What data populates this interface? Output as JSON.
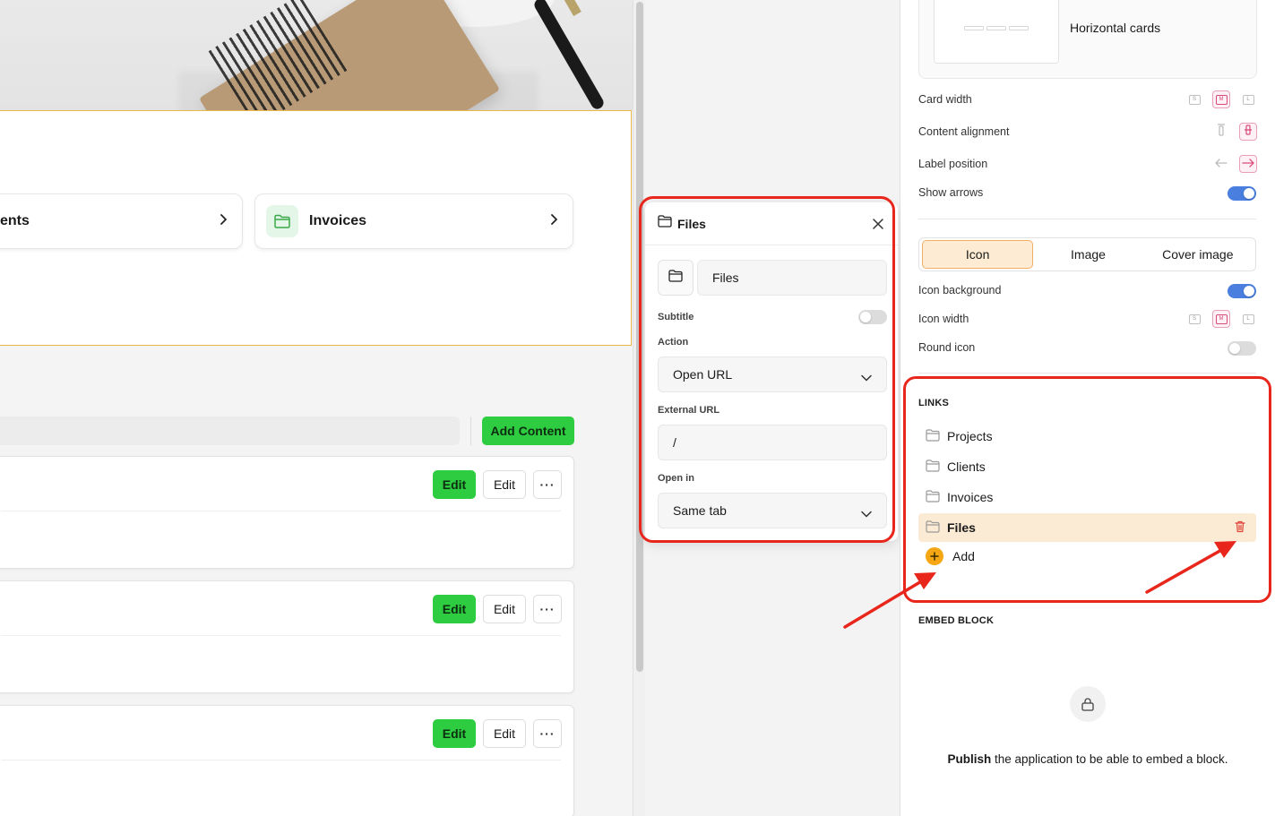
{
  "canvas": {
    "link_cards": [
      {
        "label": "ents"
      },
      {
        "label": "Invoices"
      }
    ],
    "add_content_label": "Add Content",
    "content_cards": [
      {
        "primary_label": "Edit",
        "secondary_label": "Edit",
        "more_label": "···"
      },
      {
        "primary_label": "Edit",
        "secondary_label": "Edit",
        "more_label": "···"
      },
      {
        "primary_label": "Edit",
        "secondary_label": "Edit",
        "more_label": "···"
      }
    ]
  },
  "popover": {
    "title": "Files",
    "name_value": "Files",
    "subtitle_label": "Subtitle",
    "subtitle_enabled": false,
    "action_label": "Action",
    "action_value": "Open URL",
    "external_url_label": "External URL",
    "external_url_value": "/",
    "open_in_label": "Open in",
    "open_in_value": "Same tab"
  },
  "settings": {
    "layout_name": "Horizontal cards",
    "card_width_label": "Card width",
    "card_width_options": [
      "S",
      "M",
      "L"
    ],
    "card_width_selected": "M",
    "content_alignment_label": "Content alignment",
    "label_position_label": "Label position",
    "show_arrows_label": "Show arrows",
    "show_arrows": true,
    "media_tabs": [
      "Icon",
      "Image",
      "Cover image"
    ],
    "media_selected": "Icon",
    "icon_background_label": "Icon background",
    "icon_background": true,
    "icon_width_label": "Icon width",
    "icon_width_options": [
      "S",
      "M",
      "L"
    ],
    "icon_width_selected": "M",
    "round_icon_label": "Round icon",
    "round_icon": false
  },
  "links": {
    "section_title": "LINKS",
    "items": [
      {
        "label": "Projects"
      },
      {
        "label": "Clients"
      },
      {
        "label": "Invoices"
      },
      {
        "label": "Files"
      }
    ],
    "selected": "Files",
    "add_label": "Add"
  },
  "embed": {
    "section_title": "EMBED BLOCK",
    "publish_word": "Publish",
    "message_rest": " the application to be able to embed a block."
  },
  "colors": {
    "accent_green": "#2ecc40",
    "selection_border": "#e8b84a",
    "annotation_red": "#e8261b",
    "toggle_on": "#4a7fe0",
    "add_orange": "#f4a712",
    "selected_row_bg": "#fcebd4"
  }
}
